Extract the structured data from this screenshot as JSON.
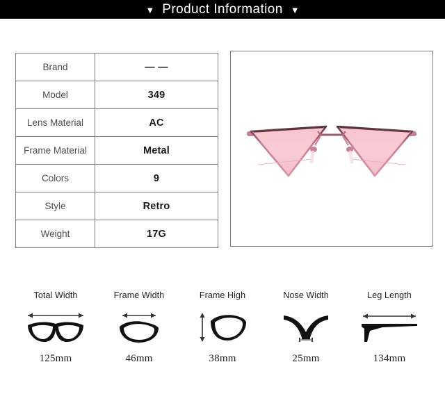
{
  "header": {
    "title": "Product Information",
    "left_triangle": "▼",
    "right_triangle": "▼",
    "background_color": "#000000",
    "text_color": "#ffffff"
  },
  "spec_table": {
    "rows": [
      {
        "label": "Brand",
        "value": "— —"
      },
      {
        "label": "Model",
        "value": "349"
      },
      {
        "label": "Lens Material",
        "value": "AC"
      },
      {
        "label": "Frame Material",
        "value": "Metal"
      },
      {
        "label": "Colors",
        "value": "9"
      },
      {
        "label": "Style",
        "value": "Retro"
      },
      {
        "label": "Weight",
        "value": "17G"
      }
    ],
    "border_color": "#7b7b7b"
  },
  "product_image": {
    "alt": "pink triangular cat-eye sunglasses with rose gold metal frame",
    "lens_color": "#f8ccd4",
    "lens_color_dark": "#f2b9c6",
    "frame_color": "#d98ba2",
    "frame_color_dark": "#5c3038",
    "temple_color": "#f0c2b8",
    "border_color": "#7b7b7b"
  },
  "measurements": [
    {
      "label": "Total Width",
      "value": "125mm",
      "icon": "total-width-icon"
    },
    {
      "label": "Frame Width",
      "value": "46mm",
      "icon": "frame-width-icon"
    },
    {
      "label": "Frame High",
      "value": "38mm",
      "icon": "frame-high-icon"
    },
    {
      "label": "Nose Width",
      "value": "25mm",
      "icon": "nose-width-icon"
    },
    {
      "label": "Leg Length",
      "value": "134mm",
      "icon": "leg-length-icon"
    }
  ]
}
